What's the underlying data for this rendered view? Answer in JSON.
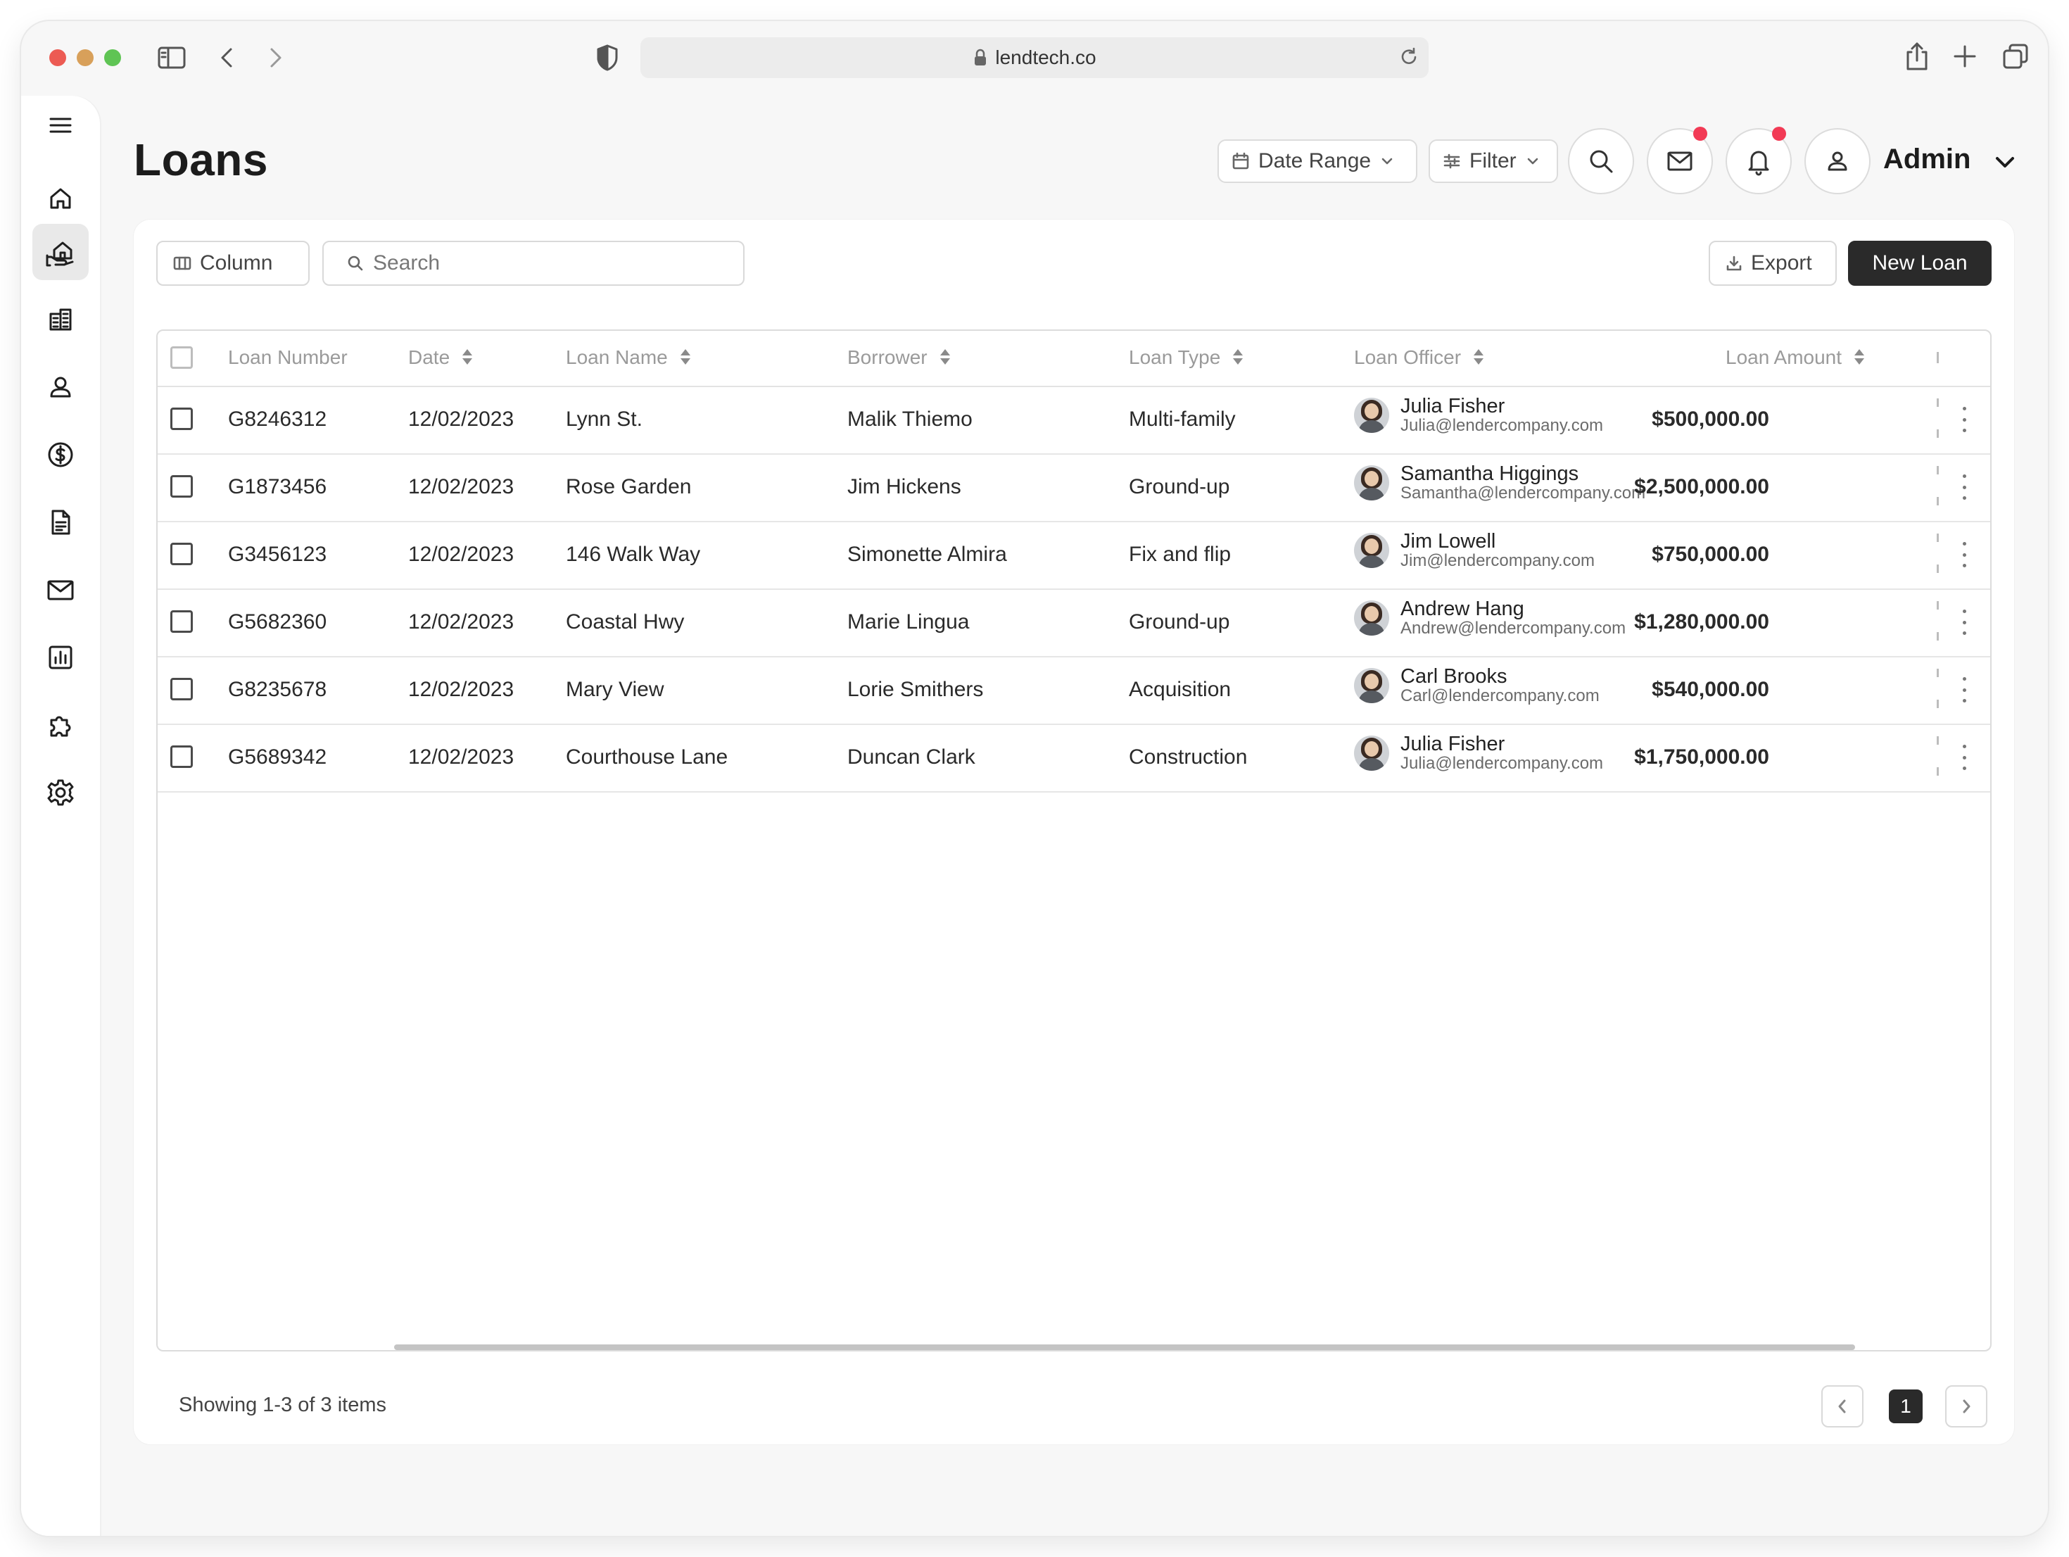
{
  "browser": {
    "url": "lendtech.co"
  },
  "sidebar": {
    "items": [
      {
        "name": "menu",
        "icon": "hamburger-icon"
      },
      {
        "name": "home",
        "icon": "home-icon"
      },
      {
        "name": "loans",
        "icon": "hand-house-icon",
        "active": true
      },
      {
        "name": "properties",
        "icon": "building-icon"
      },
      {
        "name": "users",
        "icon": "person-icon"
      },
      {
        "name": "payments",
        "icon": "dollar-circle-icon"
      },
      {
        "name": "documents",
        "icon": "document-icon"
      },
      {
        "name": "mail",
        "icon": "mail-icon"
      },
      {
        "name": "reports",
        "icon": "bar-chart-icon"
      },
      {
        "name": "integrations",
        "icon": "puzzle-icon"
      },
      {
        "name": "settings",
        "icon": "gear-icon"
      }
    ]
  },
  "header": {
    "title": "Loans",
    "date_range_label": "Date Range",
    "filter_label": "Filter",
    "user_label": "Admin",
    "mail_has_notification": true,
    "bell_has_notification": true
  },
  "toolbar": {
    "column_label": "Column",
    "search_placeholder": "Search",
    "export_label": "Export",
    "new_loan_label": "New Loan"
  },
  "table": {
    "columns": [
      "Loan Number",
      "Date",
      "Loan Name",
      "Borrower",
      "Loan Type",
      "Loan Officer",
      "Loan Amount"
    ],
    "rows": [
      {
        "loan_number": "G8246312",
        "date": "12/02/2023",
        "loan_name": "Lynn St.",
        "borrower": "Malik Thiemo",
        "loan_type": "Multi-family",
        "officer_name": "Julia Fisher",
        "officer_email": "Julia@lendercompany.com",
        "amount": "$500,000.00"
      },
      {
        "loan_number": "G1873456",
        "date": "12/02/2023",
        "loan_name": "Rose Garden",
        "borrower": "Jim Hickens",
        "loan_type": "Ground-up",
        "officer_name": "Samantha Higgings",
        "officer_email": "Samantha@lendercompany.com",
        "amount": "$2,500,000.00"
      },
      {
        "loan_number": "G3456123",
        "date": "12/02/2023",
        "loan_name": "146 Walk Way",
        "borrower": "Simonette Almira",
        "loan_type": "Fix and flip",
        "officer_name": "Jim Lowell",
        "officer_email": "Jim@lendercompany.com",
        "amount": "$750,000.00"
      },
      {
        "loan_number": "G5682360",
        "date": "12/02/2023",
        "loan_name": "Coastal Hwy",
        "borrower": "Marie Lingua",
        "loan_type": "Ground-up",
        "officer_name": "Andrew Hang",
        "officer_email": "Andrew@lendercompany.com",
        "amount": "$1,280,000.00"
      },
      {
        "loan_number": "G8235678",
        "date": "12/02/2023",
        "loan_name": "Mary View",
        "borrower": "Lorie Smithers",
        "loan_type": "Acquisition",
        "officer_name": "Carl Brooks",
        "officer_email": "Carl@lendercompany.com",
        "amount": "$540,000.00"
      },
      {
        "loan_number": "G5689342",
        "date": "12/02/2023",
        "loan_name": "Courthouse Lane",
        "borrower": "Duncan Clark",
        "loan_type": "Construction",
        "officer_name": "Julia Fisher",
        "officer_email": "Julia@lendercompany.com",
        "amount": "$1,750,000.00"
      }
    ]
  },
  "footer": {
    "showing_text": "Showing 1-3 of 3 items",
    "current_page": "1"
  },
  "colors": {
    "primary_dark": "#2a2a2a",
    "notification": "#f23a55",
    "muted_text": "#9a9a9a"
  }
}
